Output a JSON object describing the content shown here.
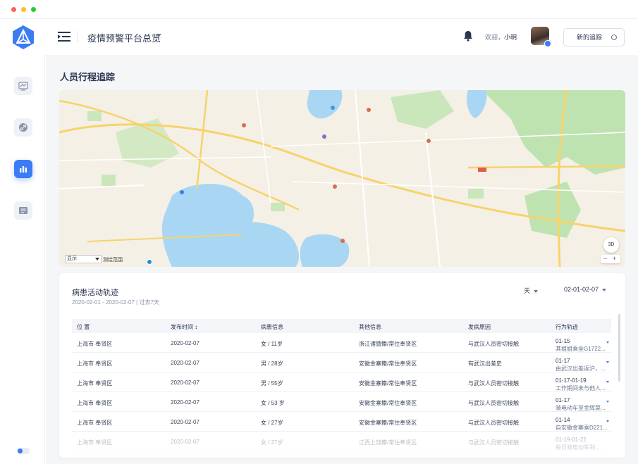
{
  "header": {
    "title": "疫情预警平台总览",
    "welcome_prefix": "欢迎，",
    "username": "小明",
    "new_trace_label": "新的追踪"
  },
  "sidebar": {
    "items": [
      {
        "icon": "trend-chart-icon",
        "active": false
      },
      {
        "icon": "link-icon",
        "active": false
      },
      {
        "icon": "bar-chart-icon",
        "active": true
      },
      {
        "icon": "list-icon",
        "active": false
      }
    ]
  },
  "page": {
    "title": "人员行程追踪"
  },
  "map": {
    "select_value": "显示",
    "scale_label": "测绘范围",
    "btn_3d": "3D",
    "zoom_out": "−",
    "zoom_in": "+"
  },
  "card": {
    "title": "病患活动轨迹",
    "subtitle": "2020-02-01 - 2020-02-07 | 过去7天",
    "period": "天",
    "date_range": "02-01-02-07",
    "columns": [
      "位 置",
      "发布时间 ↕",
      "病患信息",
      "其他信息",
      "发病原因",
      "行为轨迹"
    ],
    "rows": [
      {
        "location": "上海市 奉贤区",
        "date": "2020-02-07",
        "patient": "女 / 11岁",
        "other": "浙江诸暨籍/常住奉贤区",
        "cause": "与武汉人员密切接触",
        "trail_date": "01-15",
        "trail_desc": "其姐姐乘坐G1722..."
      },
      {
        "location": "上海市 奉贤区",
        "date": "2020-02-07",
        "patient": "男 / 28岁",
        "other": "安徽金寨籍/常住奉贤区",
        "cause": "有武汉出差史",
        "trail_date": "01-17",
        "trail_desc": "由武汉出差返沪，..."
      },
      {
        "location": "上海市 奉贤区",
        "date": "2020-02-07",
        "patient": "男 / 55岁",
        "other": "安徽金寨籍/常住奉贤区",
        "cause": "与武汉人员密切接触",
        "trail_date": "01-17-01-19",
        "trail_desc": "工作期间未与他人..."
      },
      {
        "location": "上海市 奉贤区",
        "date": "2020-02-07",
        "patient": "女 / 53 岁",
        "other": "安徽金寨籍/常住奉贤区",
        "cause": "与武汉人员密切接触",
        "trail_date": "01-17",
        "trail_desc": "骑电动车至金辉菜..."
      },
      {
        "location": "上海市 奉贤区",
        "date": "2020-02-07",
        "patient": "女 / 27岁",
        "other": "安徽金寨籍/常住奉贤区",
        "cause": "与武汉人员密切接触",
        "trail_date": "01-14",
        "trail_desc": "自安徽金寨乘D221..."
      },
      {
        "location": "上海市 奉贤区",
        "date": "2020-02-07",
        "patient": "女 / 27岁",
        "other": "江西上饶籍/常住奉贤区",
        "cause": "与武汉人员密切接触",
        "trail_date": "01-19-01-22",
        "trail_desc": "每日骑电动车到..."
      }
    ]
  },
  "colors": {
    "accent": "#3b7cf4",
    "map_water": "#a8d4f2",
    "map_green": "#b8dfa8",
    "map_road": "#f6d36b"
  }
}
